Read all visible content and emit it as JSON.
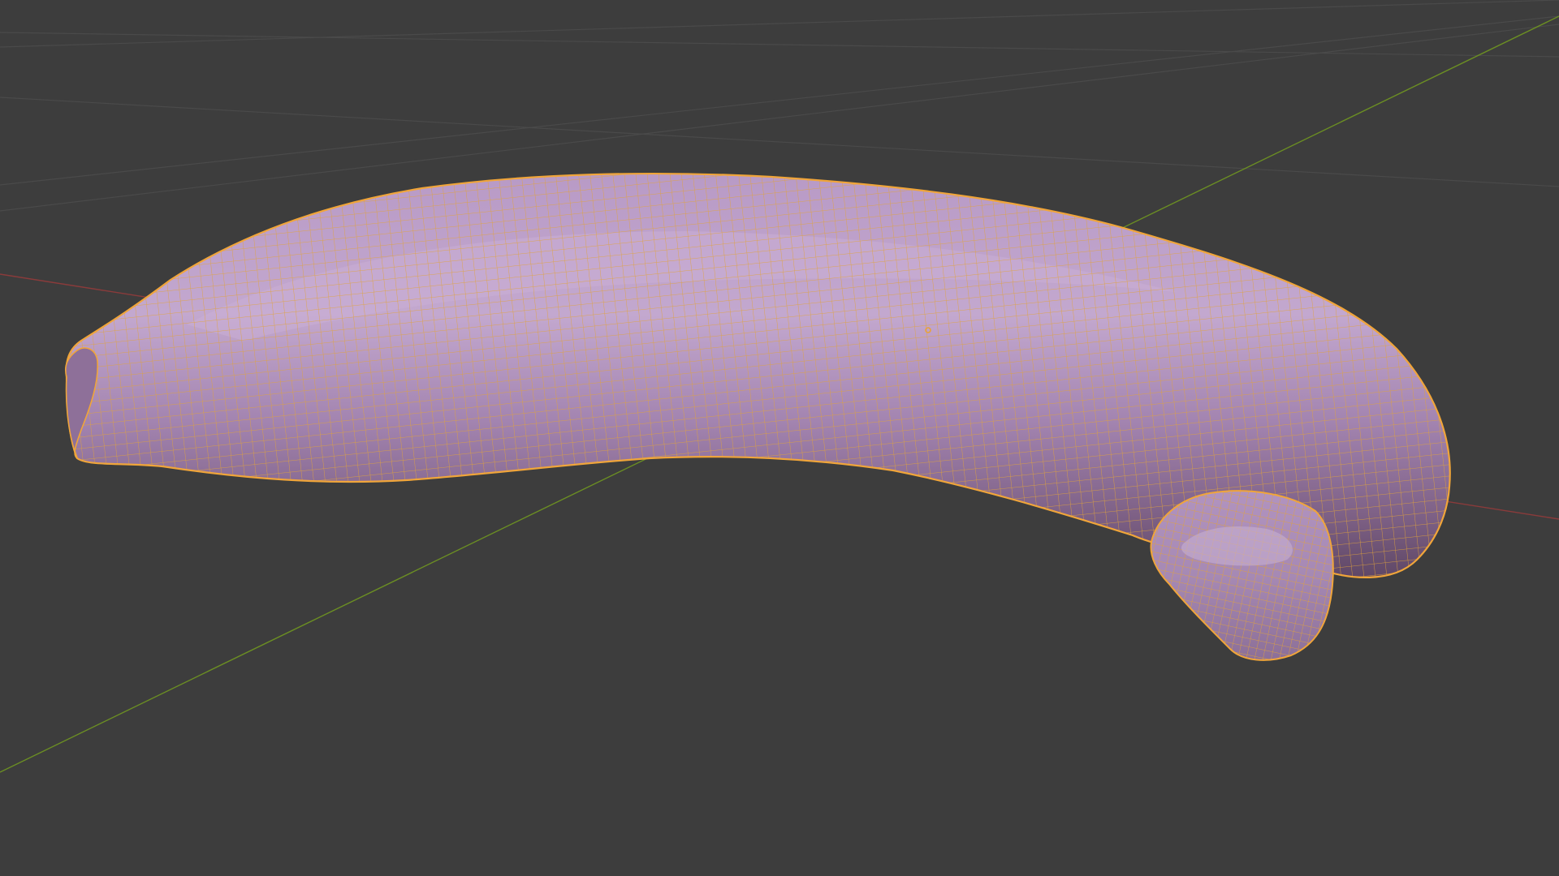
{
  "viewport": {
    "name": "3D Viewport",
    "background_color": "#3d3d3d",
    "grid_color": "#4a4a4a",
    "x_axis_color": "#8a3b3b",
    "y_axis_color": "#6b8e23"
  },
  "object": {
    "name": "banana-mesh",
    "state": "selected",
    "display": "solid-with-wireframe-overlay",
    "surface_color": "#a989b6",
    "surface_highlight": "#c3a8cf",
    "surface_shadow": "#6e5474",
    "wireframe_color": "#e1a33a",
    "outline_color": "#f0a53a",
    "origin_color": "#e8a23a",
    "segments": [
      "body",
      "stem",
      "tip"
    ]
  }
}
